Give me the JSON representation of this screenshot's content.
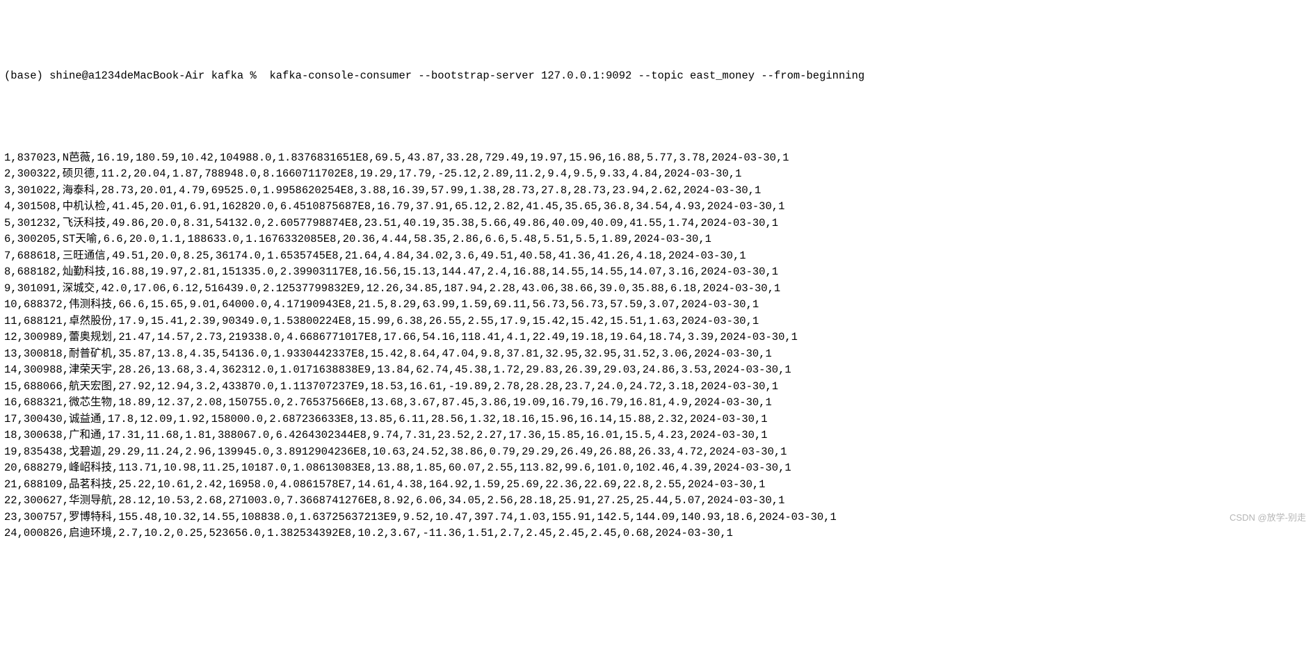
{
  "prompt": {
    "env": "(base)",
    "user_host": "shine@a1234deMacBook-Air",
    "cwd": "kafka",
    "symbol": "%",
    "command": " kafka-console-consumer --bootstrap-server 127.0.0.1:9092 --topic east_money --from-beginning"
  },
  "rows": [
    "1,837023,N芭薇,16.19,180.59,10.42,104988.0,1.8376831651E8,69.5,43.87,33.28,729.49,19.97,15.96,16.88,5.77,3.78,2024-03-30,1",
    "2,300322,硕贝德,11.2,20.04,1.87,788948.0,8.1660711702E8,19.29,17.79,-25.12,2.89,11.2,9.4,9.5,9.33,4.84,2024-03-30,1",
    "3,301022,海泰科,28.73,20.01,4.79,69525.0,1.9958620254E8,3.88,16.39,57.99,1.38,28.73,27.8,28.73,23.94,2.62,2024-03-30,1",
    "4,301508,中机认检,41.45,20.01,6.91,162820.0,6.4510875687E8,16.79,37.91,65.12,2.82,41.45,35.65,36.8,34.54,4.93,2024-03-30,1",
    "5,301232,飞沃科技,49.86,20.0,8.31,54132.0,2.6057798874E8,23.51,40.19,35.38,5.66,49.86,40.09,40.09,41.55,1.74,2024-03-30,1",
    "6,300205,ST天喻,6.6,20.0,1.1,188633.0,1.1676332085E8,20.36,4.44,58.35,2.86,6.6,5.48,5.51,5.5,1.89,2024-03-30,1",
    "7,688618,三旺通信,49.51,20.0,8.25,36174.0,1.6535745E8,21.64,4.84,34.02,3.6,49.51,40.58,41.36,41.26,4.18,2024-03-30,1",
    "8,688182,灿勤科技,16.88,19.97,2.81,151335.0,2.39903117E8,16.56,15.13,144.47,2.4,16.88,14.55,14.55,14.07,3.16,2024-03-30,1",
    "9,301091,深城交,42.0,17.06,6.12,516439.0,2.12537799832E9,12.26,34.85,187.94,2.28,43.06,38.66,39.0,35.88,6.18,2024-03-30,1",
    "10,688372,伟测科技,66.6,15.65,9.01,64000.0,4.17190943E8,21.5,8.29,63.99,1.59,69.11,56.73,56.73,57.59,3.07,2024-03-30,1",
    "11,688121,卓然股份,17.9,15.41,2.39,90349.0,1.53800224E8,15.99,6.38,26.55,2.55,17.9,15.42,15.42,15.51,1.63,2024-03-30,1",
    "12,300989,蕾奥规划,21.47,14.57,2.73,219338.0,4.6686771017E8,17.66,54.16,118.41,4.1,22.49,19.18,19.64,18.74,3.39,2024-03-30,1",
    "13,300818,耐普矿机,35.87,13.8,4.35,54136.0,1.9330442337E8,15.42,8.64,47.04,9.8,37.81,32.95,32.95,31.52,3.06,2024-03-30,1",
    "14,300988,津荣天宇,28.26,13.68,3.4,362312.0,1.0171638838E9,13.84,62.74,45.38,1.72,29.83,26.39,29.03,24.86,3.53,2024-03-30,1",
    "15,688066,航天宏图,27.92,12.94,3.2,433870.0,1.113707237E9,18.53,16.61,-19.89,2.78,28.28,23.7,24.0,24.72,3.18,2024-03-30,1",
    "16,688321,微芯生物,18.89,12.37,2.08,150755.0,2.76537566E8,13.68,3.67,87.45,3.86,19.09,16.79,16.79,16.81,4.9,2024-03-30,1",
    "17,300430,诚益通,17.8,12.09,1.92,158000.0,2.687236633E8,13.85,6.11,28.56,1.32,18.16,15.96,16.14,15.88,2.32,2024-03-30,1",
    "18,300638,广和通,17.31,11.68,1.81,388067.0,6.4264302344E8,9.74,7.31,23.52,2.27,17.36,15.85,16.01,15.5,4.23,2024-03-30,1",
    "19,835438,戈碧迦,29.29,11.24,2.96,139945.0,3.8912904236E8,10.63,24.52,38.86,0.79,29.29,26.49,26.88,26.33,4.72,2024-03-30,1",
    "20,688279,峰岹科技,113.71,10.98,11.25,10187.0,1.08613083E8,13.88,1.85,60.07,2.55,113.82,99.6,101.0,102.46,4.39,2024-03-30,1",
    "21,688109,品茗科技,25.22,10.61,2.42,16958.0,4.0861578E7,14.61,4.38,164.92,1.59,25.69,22.36,22.69,22.8,2.55,2024-03-30,1",
    "22,300627,华测导航,28.12,10.53,2.68,271003.0,7.3668741276E8,8.92,6.06,34.05,2.56,28.18,25.91,27.25,25.44,5.07,2024-03-30,1",
    "23,300757,罗博特科,155.48,10.32,14.55,108838.0,1.63725637213E9,9.52,10.47,397.74,1.03,155.91,142.5,144.09,140.93,18.6,2024-03-30,1",
    "24,000826,启迪环境,2.7,10.2,0.25,523656.0,1.382534392E8,10.2,3.67,-11.36,1.51,2.7,2.45,2.45,2.45,0.68,2024-03-30,1"
  ],
  "watermark": "CSDN @放学-别走"
}
